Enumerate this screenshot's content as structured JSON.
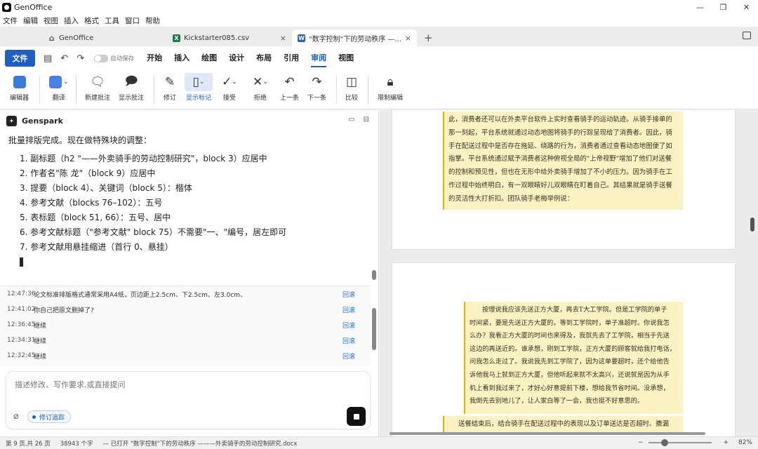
{
  "app": {
    "title": "GenOffice"
  },
  "menu": [
    "文件",
    "编辑",
    "视图",
    "插入",
    "格式",
    "工具",
    "窗口",
    "帮助"
  ],
  "tabs": [
    {
      "label": "GenOffice",
      "icon": "home-icon"
    },
    {
      "label": "Kickstarter085.csv",
      "icon": "excel-icon",
      "badge": "X",
      "color": "#1d7a45"
    },
    {
      "label": "\"数字控制\"下的劳动秩序 —...",
      "icon": "word-icon",
      "badge": "W",
      "color": "#2b5fb8"
    }
  ],
  "ribbon": {
    "file": "文件",
    "autosave": "自动保存",
    "tabs": [
      "开始",
      "插入",
      "绘图",
      "设计",
      "布局",
      "引用",
      "审阅",
      "视图"
    ],
    "active_tab": "审阅"
  },
  "toolbar": {
    "editor": "编辑器",
    "translate": "翻译",
    "new_comment": "新建批注",
    "show_comments": "显示批注",
    "revise": "修订",
    "show_markup": "显示标记",
    "accept": "接受",
    "reject": "拒绝",
    "prev": "上一条",
    "next": "下一条",
    "compare": "比较",
    "restrict": "限制编辑"
  },
  "ai": {
    "title": "Genspark",
    "intro": "批量排版完成。现在做特殊块的调整：",
    "items": [
      "1. 副标题（h2 \"——外卖骑手的劳动控制研究\"，block 3）应居中",
      "2. 作者名\"陈 龙\"（block 9）应居中",
      "3. 提要（block 4）、关键词（block 5）：楷体",
      "4. 参考文献（blocks 76–102）：五号",
      "5. 表标题（block 51, 66）：五号、居中",
      "6. 参考文献标题（\"参考文献\" block 75）不需要\"一、\"编号，居左即可",
      "7. 参考文献用悬挂缩进（首行 0、悬挂）"
    ],
    "history": [
      {
        "time": "12:47:36",
        "text": "论文标准排版格式通常采用A4纸，页边距上2.5cm、下2.5cm、左3.0cm、",
        "action": "回滚"
      },
      {
        "time": "12:41:02",
        "text": "你自己把原文删掉了?",
        "action": "回滚"
      },
      {
        "time": "12:36:45",
        "text": "继续",
        "action": "回滚"
      },
      {
        "time": "12:34:31",
        "text": "继续",
        "action": "回滚"
      },
      {
        "time": "12:32:45",
        "text": "继续",
        "action": "回滚"
      }
    ],
    "input_placeholder": "描述修改、写作要求,或直接提问",
    "track_changes": "修订追踪"
  },
  "document": {
    "page1_lines": [
      "此，消费者还可以在外卖平台软件上实时查看骑手的运动轨迹。从骑手接单的",
      "那一刻起，平台系统就通过动态地图将骑手的行踪呈现给了消费者。因此，骑",
      "手在配送过程中是否存在拖延、绕路的行为，消费者通过查看动态地图便了如",
      "指掌。平台系统通过赋予消费者这种俯视全局的\"上帝视野\"增加了他们对送餐",
      "的控制和预见性，但也在无形中给外卖骑手增加了不小的压力。因为骑手在工",
      "作过程中始终明白，有一双眼睛好儿双眼睛在盯着自己。其结果就是骑手送餐",
      "的灵活性大打折扣。团队骑手老梅举例说："
    ],
    "page2_quote": [
      "按理说我应该先送正方大厦，再去T大工学院。但是工学院的单子",
      "时间紧，要是先送正方大厦的，等到工学院时，单子准超时。你说我怎",
      "么办？我看正方大厦的时间也来得及，我就先去了工学院，相当于先送",
      "这边的再送近的。谁承想，刚到工学院，正方大厦的顾客就给我打电话，",
      "问我怎么走过了。我说我先到工学院了，因为这单要超时，还个给他告",
      "诉他我马上就到正方大厦，但他听起来就不太高兴，还说就是因为从手",
      "机上看到我过来了，才好心好意提前下楼，想给我节省时间。没承想，",
      "我倒先去别地儿了，让人家白等了一会，我也挺不好意思的。"
    ],
    "page2_after": "送餐结束后，结合骑手在配送过程中的表现以及订单送达是否超时、撒漏"
  },
  "status": {
    "page": "第 9 页,共 26 页",
    "words": "38943 个字",
    "opened": "— 已打开 \"数字控制\"下的劳动秩序 ———外卖骑手的劳动控制研究.docx",
    "zoom": "82%",
    "zoom_minus": "−",
    "zoom_plus": "+"
  },
  "colors": {
    "accent": "#1e5fbf",
    "highlight": "#fbf2c4",
    "highlight_border": "#e0b400",
    "link": "#1e6fd9"
  }
}
